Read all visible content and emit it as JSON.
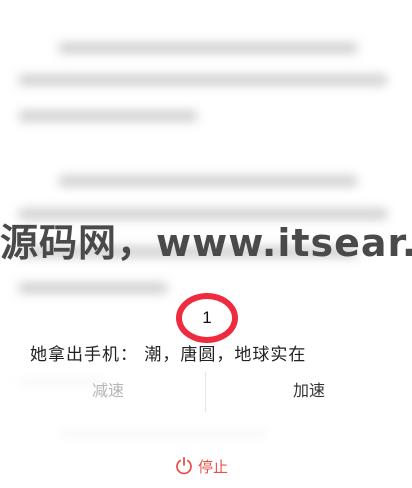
{
  "reader": {
    "visible_text": "她拿出手机：     潮，唐圆，地球实在"
  },
  "watermark": {
    "text": "源码网，www.itsear."
  },
  "controls": {
    "slow_label": "减速",
    "fast_label": "加速",
    "stop_label": "停止"
  },
  "annotation": {
    "number": "1",
    "color": "#ee2b3f"
  },
  "colors": {
    "accent": "#e8504a",
    "disabled_text": "#b5b5b5",
    "active_text": "#333333"
  }
}
